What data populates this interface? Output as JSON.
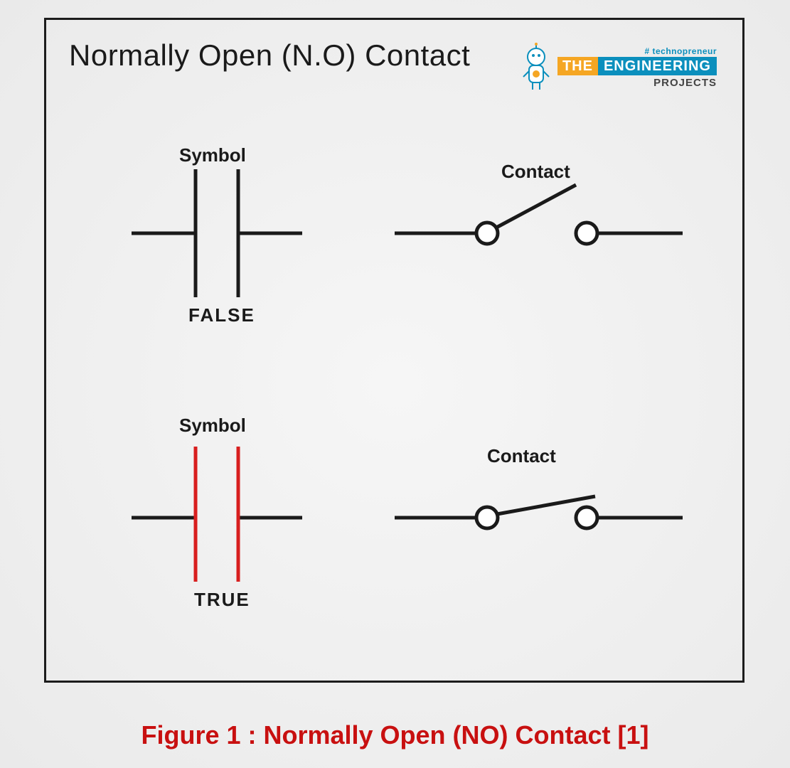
{
  "title": "Normally Open (N.O) Contact",
  "logo": {
    "tag": "# technopreneur",
    "the": "THE",
    "eng": "ENGINEERING",
    "projects": "PROJECTS"
  },
  "labels": {
    "symbol_top": "Symbol",
    "contact_top": "Contact",
    "false_state": "FALSE",
    "symbol_bottom": "Symbol",
    "contact_bottom": "Contact",
    "true_state": "TRUE"
  },
  "caption": "Figure 1 : Normally Open (NO) Contact [1]",
  "colors": {
    "stroke": "#1a1a1a",
    "active": "#d81e1e"
  }
}
